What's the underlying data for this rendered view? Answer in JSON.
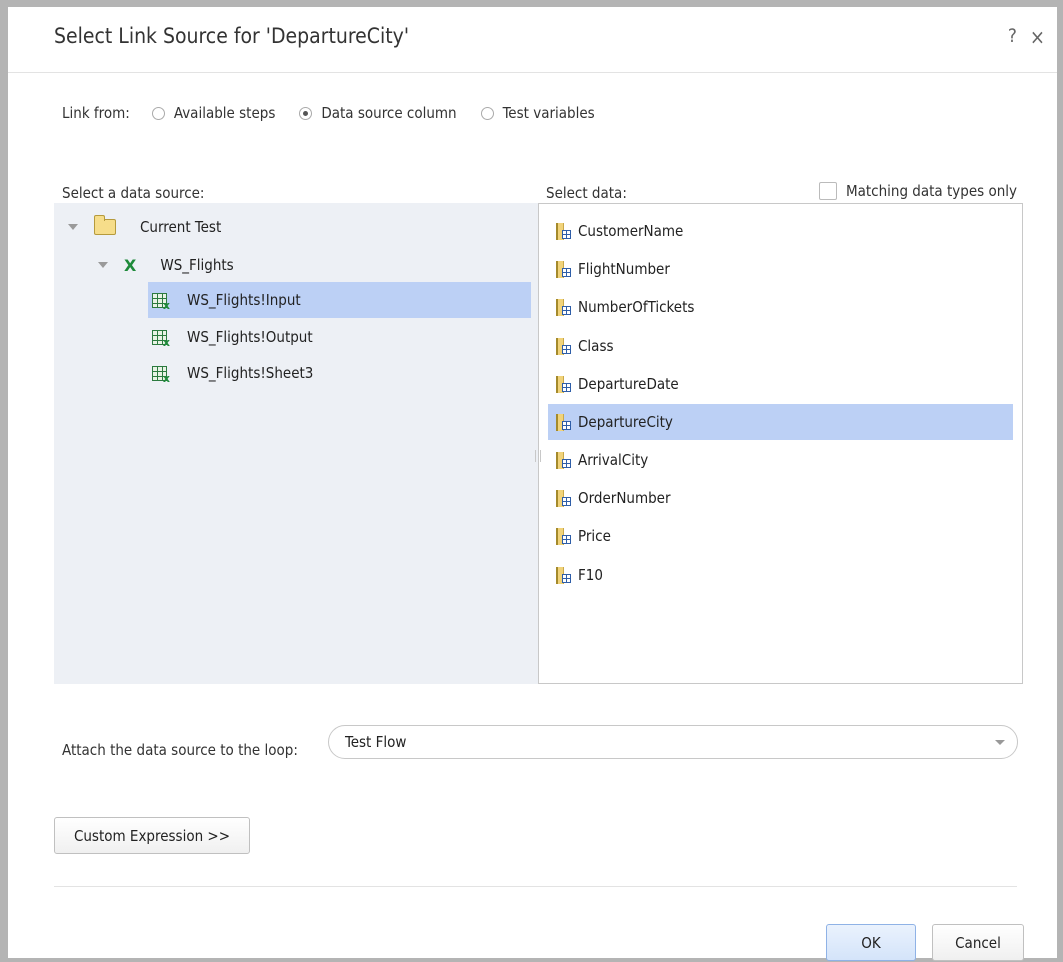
{
  "dialog": {
    "title": "Select Link Source for 'DepartureCity'",
    "help_label": "?",
    "close_label": "×"
  },
  "link_from": {
    "label": "Link from:",
    "options": [
      {
        "label": "Available steps",
        "selected": false
      },
      {
        "label": "Data source column",
        "selected": true
      },
      {
        "label": "Test variables",
        "selected": false
      }
    ]
  },
  "data_source": {
    "label": "Select a data source:",
    "tree": [
      {
        "label": "Current Test",
        "icon": "folder-icon"
      },
      {
        "label": "WS_Flights",
        "icon": "excel-icon"
      },
      {
        "label": "WS_Flights!Input",
        "icon": "sheet-icon",
        "selected": true
      },
      {
        "label": "WS_Flights!Output",
        "icon": "sheet-icon"
      },
      {
        "label": "WS_Flights!Sheet3",
        "icon": "sheet-icon"
      }
    ]
  },
  "select_data": {
    "label": "Select data:",
    "matching_label": "Matching data types only",
    "matching_checked": false,
    "columns": [
      "CustomerName",
      "FlightNumber",
      "NumberOfTickets",
      "Class",
      "DepartureDate",
      "DepartureCity",
      "ArrivalCity",
      "OrderNumber",
      "Price",
      "F10"
    ],
    "selected": "DepartureCity"
  },
  "attach": {
    "label": "Attach the data source to the loop:",
    "value": "Test Flow"
  },
  "buttons": {
    "custom_expression": "Custom Expression >>",
    "ok": "OK",
    "cancel": "Cancel"
  },
  "colors": {
    "selection": "#bcd0f5",
    "pane_bg": "#edf0f5"
  }
}
